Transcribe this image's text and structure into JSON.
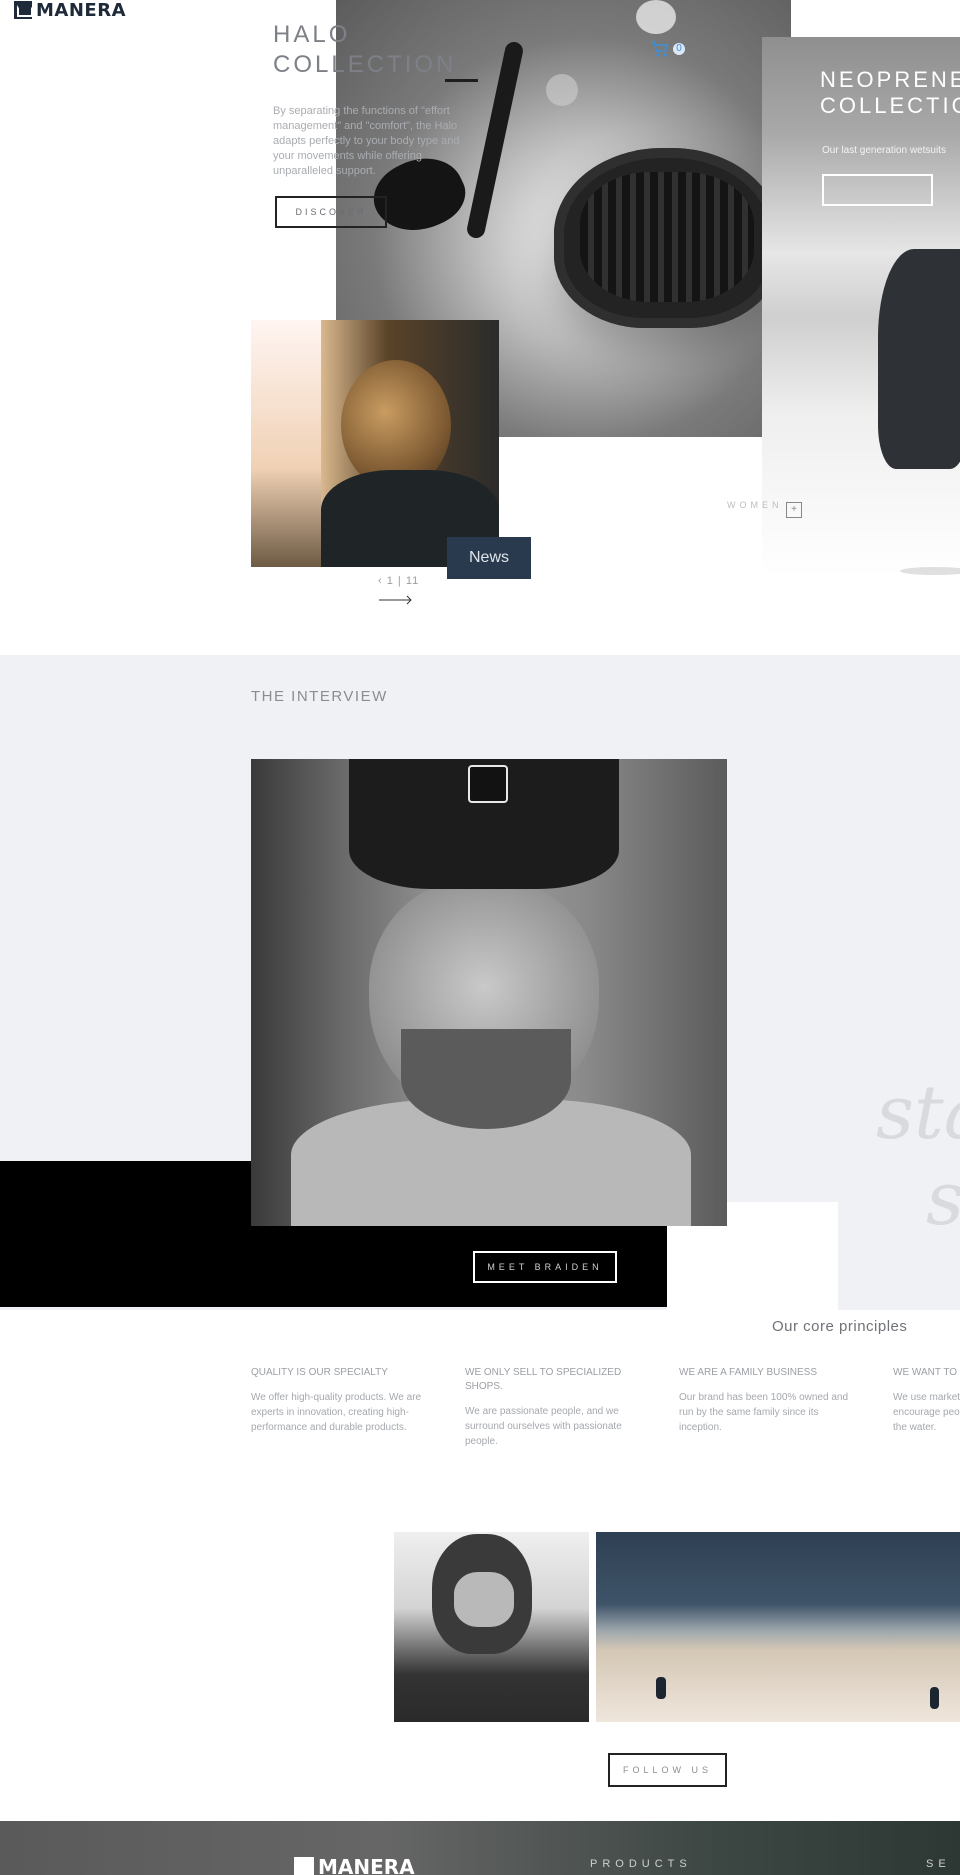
{
  "brand": {
    "name": "MANERA"
  },
  "cart": {
    "count": "0"
  },
  "hero": {
    "halo_title_1": "HALO",
    "halo_title_2": "COLLECTION",
    "halo_desc": "By separating the functions of \"effort management\" and \"comfort\", the Halo adapts perfectly to your body type and your movements while offering unparalleled support.",
    "discover_label": "DISCOVER",
    "neo_title_1": "NEOPRENE",
    "neo_title_2": "COLLECTION",
    "neo_desc": "Our last generation wetsuits",
    "women_label": "WOMEN",
    "women_symbol": "+"
  },
  "news": {
    "tag": "News",
    "pager": "1 | 11",
    "prev_symbol": "‹"
  },
  "interview": {
    "title": "THE INTERVIEW",
    "meet_label": "MEET BRAIDEN",
    "script_1": "sta",
    "script_2": "s"
  },
  "core": {
    "title": "Our core principles",
    "items": [
      {
        "heading": "QUALITY IS OUR SPECIALTY",
        "text": "We offer high-quality products. We are experts in innovation, creating high-performance and durable products."
      },
      {
        "heading": "WE ONLY SELL TO SPECIALIZED SHOPS.",
        "text": "We are passionate people, and we surround ourselves with passionate people."
      },
      {
        "heading": "WE ARE A FAMILY BUSINESS",
        "text": "Our brand has been 100% owned and run by the same family since its inception."
      },
      {
        "heading": "WE WANT TO PROTECT OUR SPOTS.",
        "text": "We use marketing to gather and to encourage people to spend more time in the water."
      }
    ]
  },
  "social": {
    "follow_label": "FOLLOW US"
  },
  "footer": {
    "brand": "MANERA",
    "link_products": "PRODUCTS",
    "link_second": "SE"
  },
  "colors": {
    "brand_navy": "#1e2a3a",
    "news_tag": "#2a3a4e",
    "cart_blue": "#3f8fd8",
    "section_gray": "#f0f1f4"
  },
  "icons": {
    "cart": "shopping-cart-icon",
    "logo": "manera-crown-logo"
  }
}
